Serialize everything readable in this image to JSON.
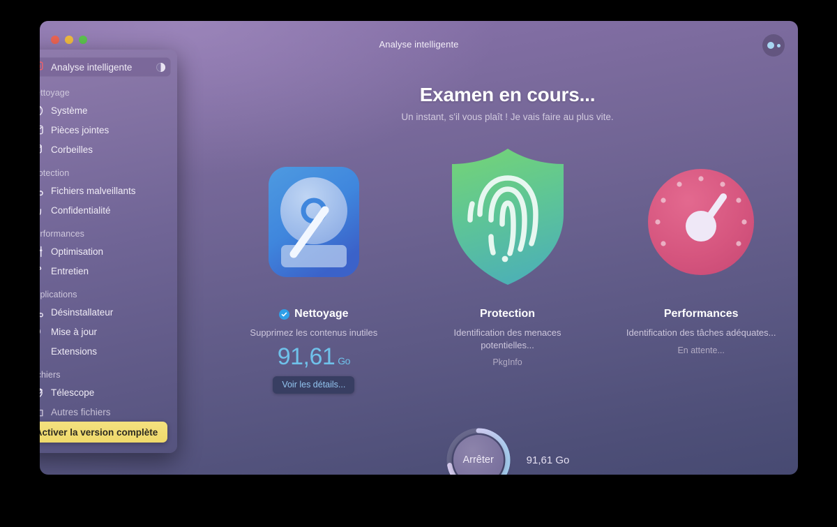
{
  "window": {
    "title": "Analyse intelligente",
    "traffic_lights": [
      "close",
      "minimize",
      "zoom"
    ],
    "account_button_name": "account-avatar"
  },
  "sidebar": {
    "selected": {
      "label": "Analyse intelligente",
      "icon": "monitor-scan-icon",
      "progress_indicator": "half-circle-spinner"
    },
    "groups": [
      {
        "heading": "Nettoyage",
        "items": [
          {
            "label": "Système",
            "icon": "system-icon"
          },
          {
            "label": "Pièces jointes",
            "icon": "mail-envelope-icon"
          },
          {
            "label": "Corbeilles",
            "icon": "trash-bin-icon"
          }
        ]
      },
      {
        "heading": "Protection",
        "items": [
          {
            "label": "Fichiers malveillants",
            "icon": "biohazard-icon"
          },
          {
            "label": "Confidentialité",
            "icon": "hand-privacy-icon"
          }
        ]
      },
      {
        "heading": "Performances",
        "items": [
          {
            "label": "Optimisation",
            "icon": "sliders-icon"
          },
          {
            "label": "Entretien",
            "icon": "wrench-icon"
          }
        ]
      },
      {
        "heading": "Applications",
        "items": [
          {
            "label": "Désinstallateur",
            "icon": "uninstaller-icon"
          },
          {
            "label": "Mise à jour",
            "icon": "updater-arrow-icon"
          },
          {
            "label": "Extensions",
            "icon": "puzzle-piece-icon"
          }
        ]
      },
      {
        "heading": "Fichiers",
        "items": [
          {
            "label": "Télescope",
            "icon": "space-lens-icon"
          },
          {
            "label": "Autres fichiers",
            "icon": "folder-icon",
            "dim": true
          }
        ]
      }
    ],
    "activate_button": "Activer la version complète"
  },
  "main": {
    "heading": "Examen en cours...",
    "subheading": "Un instant, s'il vous plaît ! Je vais faire au plus vite.",
    "cards": [
      {
        "id": "nettoyage",
        "title": "Nettoyage",
        "icon": "hard-drive-icon",
        "completed": true,
        "description": "Supprimez les contenus inutiles",
        "size_value": "91,61",
        "size_unit": "Go",
        "details_label": "Voir les détails..."
      },
      {
        "id": "protection",
        "title": "Protection",
        "icon": "shield-fingerprint-icon",
        "completed": false,
        "description": "Identification des menaces potentielles...",
        "status": "PkgInfo"
      },
      {
        "id": "performances",
        "title": "Performances",
        "icon": "speedometer-gauge-icon",
        "completed": false,
        "description": "Identification des tâches adéquates...",
        "status": "En attente..."
      }
    ]
  },
  "footer": {
    "stop_label": "Arrêter",
    "total_size": "91,61 Go",
    "progress_percent": 72
  },
  "colors": {
    "accent_blue": "#6fc1ea",
    "clean_icon": "#3f8fe0",
    "protection_green": "#5fc98a",
    "performance_pink": "#d9567f",
    "activate_yellow": "#f0da6c",
    "bg_top": "#8d76ad",
    "bg_bottom": "#474a72"
  }
}
